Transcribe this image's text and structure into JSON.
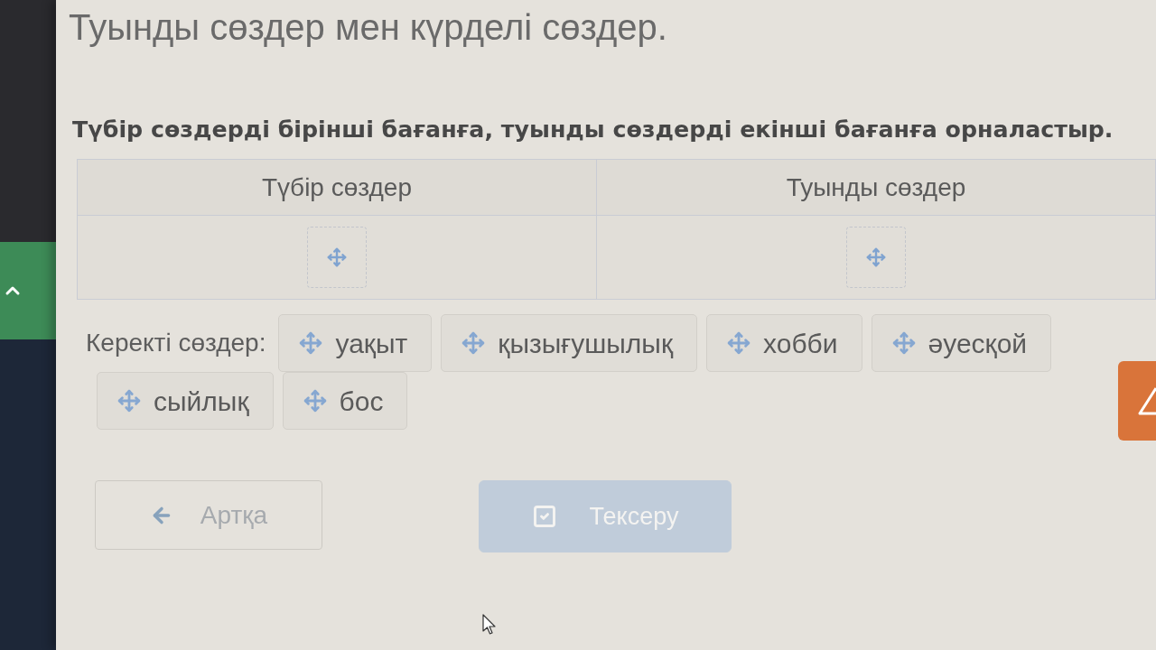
{
  "title": "Туынды сөздер мен күрделі сөздер.",
  "task": {
    "instruction": "Түбір сөздерді бірінші бағанға, туынды сөздерді екінші бағанға орналастыр.",
    "columns": [
      {
        "heading": "Түбір сөздер"
      },
      {
        "heading": "Туынды сөздер"
      }
    ]
  },
  "word_bank": {
    "label": "Керекті сөздер:",
    "words": [
      "уақыт",
      "қызығушылық",
      "хобби",
      "әуесқой",
      "сыйлық",
      "бос"
    ]
  },
  "buttons": [
    {
      "label": "Артқа",
      "kind": "back",
      "disabled": true
    },
    {
      "label": "Тексеру",
      "kind": "check",
      "disabled": true
    }
  ]
}
